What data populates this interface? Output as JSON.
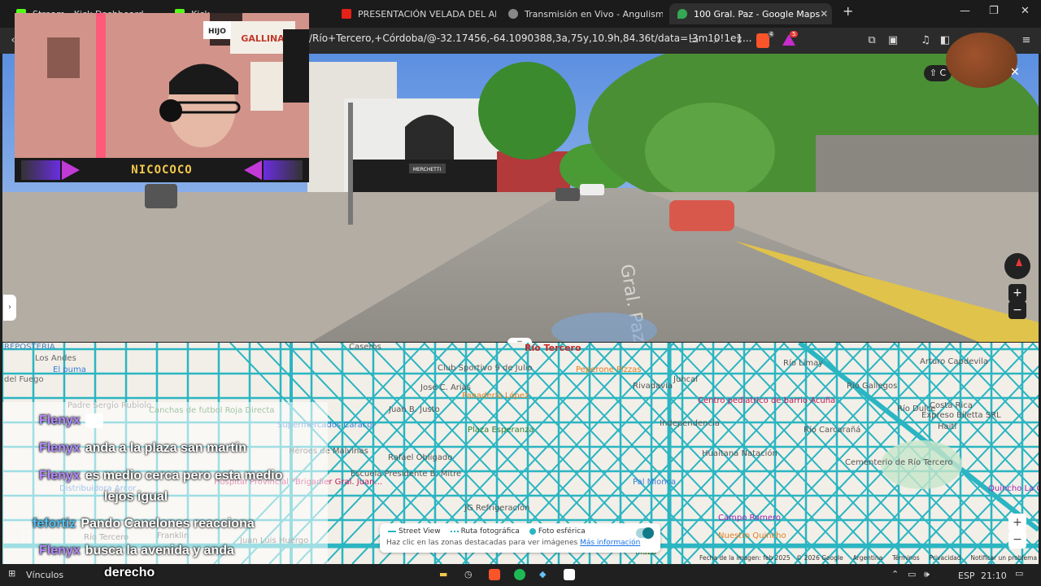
{
  "browser": {
    "tabs": [
      {
        "title": "Stream - Kick Dashboard",
        "active": false
      },
      {
        "title": "Kick",
        "active": false
      },
      {
        "title": "PRESENTACIÓN VELADA DEL AÑO V",
        "active": false
      },
      {
        "title": "Transmisión en Vivo - Angulismo",
        "active": false
      },
      {
        "title": "100 Gral. Paz - Google Maps",
        "active": true
      }
    ],
    "new_tab_symbol": "+",
    "url": "/Río+Tercero,+Córdoba/@-32.17456,-64.1090388,3a,75y,10.9h,84.36t/data=!3m10!1e1...",
    "notif_count": "5",
    "shields_count": "4"
  },
  "webcam": {
    "streamer_name": "NICOCOCO",
    "poster_text": "GALLINA",
    "poster_text_2": "HIJO"
  },
  "streetview": {
    "road_marking": "Gral. Paz",
    "shop_sign": "MERCHETTI",
    "share_label": "C",
    "zoom_in": "+",
    "zoom_out": "−",
    "drag_handle": "="
  },
  "map": {
    "city_label": "Río Tercero",
    "zoom_in": "+",
    "zoom_out": "−",
    "places": [
      {
        "name": "REPOSTERÍA",
        "color": "#4a7fc0"
      },
      {
        "name": "Los Andes",
        "color": "#666"
      },
      {
        "name": "El puma",
        "color": "#3a7bd5"
      },
      {
        "name": "del Fuego",
        "color": "#666"
      },
      {
        "name": "Padre Sergio Rubiolo",
        "color": "#666"
      },
      {
        "name": "Canchas de futbol Roja Directa",
        "color": "#2e7d32"
      },
      {
        "name": "Supermercados Caracol",
        "color": "#3a7bd5"
      },
      {
        "name": "Club Sportivo 9 de Julio",
        "color": "#555"
      },
      {
        "name": "Peperone Pizzas",
        "color": "#e67e22"
      },
      {
        "name": "Panadería López",
        "color": "#e67e22"
      },
      {
        "name": "Centro pediatrico de barrio Acuña",
        "color": "#c2185b"
      },
      {
        "name": "Huaitana Natación",
        "color": "#555"
      },
      {
        "name": "Escuela Presidente B. Mitre",
        "color": "#555"
      },
      {
        "name": "Hospital Provincial \"Brigadier Gral. Juan...",
        "color": "#c2185b"
      },
      {
        "name": "Distribuidora Arcor",
        "color": "#3a7bd5"
      },
      {
        "name": "JG Refrigeración",
        "color": "#555"
      },
      {
        "name": "Pal Mionca",
        "color": "#3a7bd5"
      },
      {
        "name": "Campo Romero",
        "color": "#9c27b0"
      },
      {
        "name": "Nuestro Quincho",
        "color": "#e67e22"
      },
      {
        "name": "Cementerio de Río Tercero",
        "color": "#555"
      },
      {
        "name": "Expreso Biletta SRL",
        "color": "#555"
      },
      {
        "name": "Quincho La C",
        "color": "#9c27b0"
      },
      {
        "name": "Plaza Esperanza",
        "color": "#2e7d32"
      },
      {
        "name": "Arturo Capdevila",
        "color": "#555"
      },
      {
        "name": "Río Gallegos",
        "color": "#555"
      },
      {
        "name": "Río Limay",
        "color": "#555"
      },
      {
        "name": "Río Dulce",
        "color": "#555"
      },
      {
        "name": "Costa Rica",
        "color": "#555"
      },
      {
        "name": "Haití",
        "color": "#555"
      },
      {
        "name": "Río Carcarañá",
        "color": "#555"
      },
      {
        "name": "Juncal",
        "color": "#555"
      },
      {
        "name": "Independencia",
        "color": "#555"
      },
      {
        "name": "Rivadavia",
        "color": "#555"
      },
      {
        "name": "Caseros",
        "color": "#555"
      },
      {
        "name": "José C. Arias",
        "color": "#555"
      },
      {
        "name": "Juan B. Justo",
        "color": "#555"
      },
      {
        "name": "Rafael Obligado",
        "color": "#555"
      },
      {
        "name": "Héroes de Malvinas",
        "color": "#555"
      },
      {
        "name": "Juan Luis Huergo",
        "color": "#555"
      },
      {
        "name": "Franklin",
        "color": "#555"
      },
      {
        "name": "Río Tercero",
        "color": "#555"
      },
      {
        "name": "Plaza",
        "color": "#2e7d32"
      }
    ],
    "legend": {
      "street_view": "Street View",
      "photo_route": "Ruta fotográfica",
      "spherical": "Foto esférica",
      "hint": "Haz clic en las zonas destacadas para ver imágenes",
      "more_info": "Más información"
    },
    "footer": [
      "Fecha de la imagen: feb 2025",
      "© 2026 Google",
      "Argentina",
      "Términos",
      "Privacidad",
      "Notificar un problema"
    ]
  },
  "chat": [
    {
      "user": "Flenyx",
      "message": "",
      "alt": false,
      "emote": true
    },
    {
      "user": "Flenyx",
      "message": "anda a la plaza san martín",
      "alt": false
    },
    {
      "user": "Flenyx",
      "message": "es medio cerca pero esta medio",
      "message2": "lejos igual",
      "alt": false
    },
    {
      "user": "fefortiz",
      "message": "Pando Canelones reacciona",
      "alt": true
    },
    {
      "user": "Flenyx",
      "message": "busca la avenida y anda",
      "message2": "derecho",
      "alt": false
    }
  ],
  "taskbar": {
    "vinculos": "Vínculos",
    "lang": "ESP",
    "time": "21:10"
  },
  "colors": {
    "map_road": "#2bb5c2",
    "map_bg": "#f2efe8",
    "chat_user": "#b388ff",
    "streamer_name": "#f2c94c"
  }
}
